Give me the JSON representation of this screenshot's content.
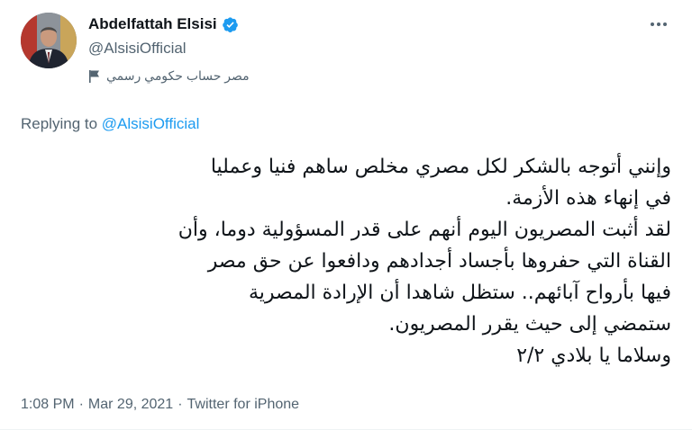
{
  "author": {
    "display_name": "Abdelfattah Elsisi",
    "handle": "@AlsisiOfficial",
    "account_label": "مصر حساب حكومي رسمي"
  },
  "reply": {
    "prefix": "Replying to ",
    "target": "@AlsisiOfficial"
  },
  "tweet": {
    "lines": [
      "وإنني أتوجه بالشكر لكل مصري مخلص ساهم فنيا وعمليا",
      "في إنهاء هذه الأزمة.",
      "لقد أثبت المصريون اليوم أنهم على قدر المسؤولية دوما، وأن",
      "القناة التي حفروها بأجساد أجدادهم ودافعوا عن حق مصر",
      "فيها بأرواح آبائهم.. ستظل شاهدا أن الإرادة المصرية",
      "ستمضي إلى حيث يقرر المصريون.",
      "وسلاما يا بلادي ٢/٢"
    ]
  },
  "meta": {
    "time": "1:08 PM",
    "date": "Mar 29, 2021",
    "source": "Twitter for iPhone",
    "separator": "·"
  },
  "icons": {
    "verified": "verified-badge-icon",
    "label": "flag-icon",
    "more": "more-icon"
  },
  "colors": {
    "link": "#1d9bf0",
    "secondary_text": "#536471",
    "primary_text": "#0f1419"
  }
}
